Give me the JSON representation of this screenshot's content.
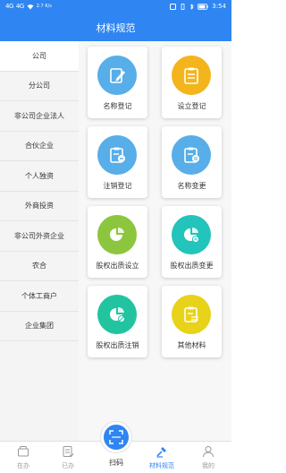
{
  "status_bar": {
    "signal_left": "4G",
    "signal_right": "4G",
    "net_speed": "2.7 K/s",
    "time": "3:54",
    "battery": "battery-icon"
  },
  "header": {
    "title": "材料规范"
  },
  "categories": [
    {
      "label": "公司",
      "active": true
    },
    {
      "label": "分公司"
    },
    {
      "label": "非公司企业法人"
    },
    {
      "label": "合伙企业"
    },
    {
      "label": "个人独资"
    },
    {
      "label": "外商投资"
    },
    {
      "label": "非公司外资企业"
    },
    {
      "label": "农合"
    },
    {
      "label": "个体工商户"
    },
    {
      "label": "企业集团"
    }
  ],
  "cards": [
    {
      "label": "名称登记",
      "color": "#57aee8",
      "icon": "name-registration-icon"
    },
    {
      "label": "设立登记",
      "color": "#f4b51c",
      "icon": "establishment-registration-icon"
    },
    {
      "label": "注销登记",
      "color": "#57aee8",
      "icon": "cancellation-registration-icon"
    },
    {
      "label": "名称变更",
      "color": "#57aee8",
      "icon": "name-change-icon"
    },
    {
      "label": "股权出质设立",
      "color": "#8cc63e",
      "icon": "equity-pledge-establish-icon"
    },
    {
      "label": "股权出质变更",
      "color": "#22c4bb",
      "icon": "equity-pledge-change-icon"
    },
    {
      "label": "股权出质注销",
      "color": "#22c4a0",
      "icon": "equity-pledge-cancel-icon"
    },
    {
      "label": "其他材料",
      "color": "#e8d21a",
      "icon": "other-materials-icon"
    }
  ],
  "bottom_nav": {
    "items": [
      {
        "label": "在办",
        "icon": "inbox-icon"
      },
      {
        "label": "已办",
        "icon": "done-doc-icon"
      },
      {
        "label": "材料规范",
        "icon": "material-norm-icon",
        "active": true
      },
      {
        "label": "我的",
        "icon": "user-icon"
      }
    ],
    "scan": {
      "label": "扫码",
      "icon": "scan-icon"
    }
  },
  "colors": {
    "primary": "#2f86f2"
  }
}
